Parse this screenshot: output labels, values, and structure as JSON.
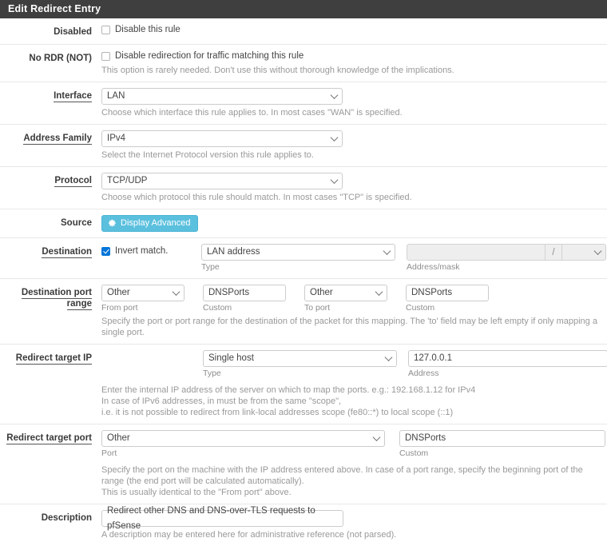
{
  "panel": {
    "title": "Edit Redirect Entry"
  },
  "rows": {
    "disabled": {
      "label": "Disabled",
      "checkbox_label": "Disable this rule",
      "checked": false
    },
    "no_rdr": {
      "label": "No RDR (NOT)",
      "checkbox_label": "Disable redirection for traffic matching this rule",
      "checked": false,
      "help": "This option is rarely needed. Don't use this without thorough knowledge of the implications."
    },
    "interface": {
      "label": "Interface",
      "value": "LAN",
      "help": "Choose which interface this rule applies to. In most cases \"WAN\" is specified."
    },
    "address_family": {
      "label": "Address Family",
      "value": "IPv4",
      "help": "Select the Internet Protocol version this rule applies to."
    },
    "protocol": {
      "label": "Protocol",
      "value": "TCP/UDP",
      "help": "Choose which protocol this rule should match. In most cases \"TCP\" is specified."
    },
    "source": {
      "label": "Source",
      "button_label": "Display Advanced",
      "button_icon": "gear-icon",
      "button_color": "#5bc0de"
    },
    "destination": {
      "label": "Destination",
      "invert_label": "Invert match.",
      "invert_checked": true,
      "type_value": "LAN address",
      "type_hint": "Type",
      "address_value": "",
      "address_hint": "Address/mask",
      "separator": "/",
      "mask_value": "",
      "address_disabled": true
    },
    "dest_port_range": {
      "label": "Destination port range",
      "from_select": "Other",
      "from_hint": "From port",
      "from_custom": "DNSPorts",
      "from_custom_hint": "Custom",
      "to_select": "Other",
      "to_hint": "To port",
      "to_custom": "DNSPorts",
      "to_custom_hint": "Custom",
      "help": "Specify the port or port range for the destination of the packet for this mapping. The 'to' field may be left empty if only mapping a single port."
    },
    "redirect_target_ip": {
      "label": "Redirect target IP",
      "type_value": "Single host",
      "type_hint": "Type",
      "address_value": "127.0.0.1",
      "address_hint": "Address",
      "help_line1": "Enter the internal IP address of the server on which to map the ports. e.g.: 192.168.1.12 for IPv4",
      "help_line2": "In case of IPv6 addresses, in must be from the same \"scope\",",
      "help_line3": "i.e. it is not possible to redirect from link-local addresses scope (fe80::*) to local scope (::1)"
    },
    "redirect_target_port": {
      "label": "Redirect target port",
      "port_select": "Other",
      "port_hint": "Port",
      "custom_value": "DNSPorts",
      "custom_hint": "Custom",
      "help_line1": "Specify the port on the machine with the IP address entered above. In case of a port range, specify the beginning port of the range (the end port will be calculated automatically).",
      "help_line2": "This is usually identical to the \"From port\" above."
    },
    "description": {
      "label": "Description",
      "value": "Redirect other DNS and DNS-over-TLS requests to pfSense",
      "help": "A description may be entered here for administrative reference (not parsed)."
    }
  }
}
